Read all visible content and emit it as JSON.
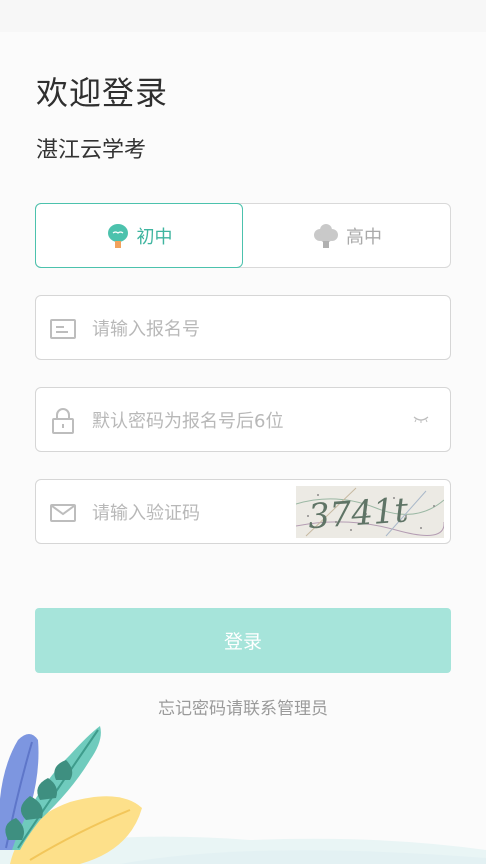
{
  "header": {
    "welcome": "欢迎登录",
    "subtitle": "湛江云学考"
  },
  "tabs": [
    {
      "label": "初中",
      "selected": true,
      "icon": "tree-icon"
    },
    {
      "label": "高中",
      "selected": false,
      "icon": "tree-icon"
    }
  ],
  "form": {
    "registration_placeholder": "请输入报名号",
    "password_placeholder": "默认密码为报名号后6位",
    "captcha_placeholder": "请输入验证码",
    "captcha_text": "3741t"
  },
  "login_label": "登录",
  "forgot_text": "忘记密码请联系管理员",
  "colors": {
    "accent": "#4cc2ad",
    "button": "#a6e4da",
    "placeholder": "#b8b8b8"
  }
}
